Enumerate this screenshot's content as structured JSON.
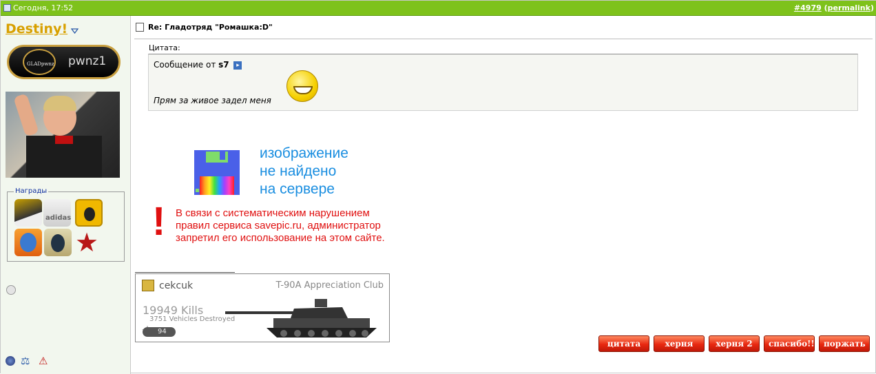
{
  "header": {
    "date": "Сегодня, 17:52",
    "post_number": "#4979",
    "permalink": "permalink"
  },
  "user": {
    "name": "Destiny!",
    "clan_tag": "pwnz1",
    "clan_emblem_text": "GLADpwnz"
  },
  "awards": {
    "legend": "Награды",
    "items": [
      "stripes-award",
      "adidas-award",
      "medal-award",
      "masked-hero-award",
      "counter-strike-award",
      "soviet-star-award"
    ],
    "adidas_text": "adidas"
  },
  "post": {
    "title": "Re: Гладотряд \"Ромашка:D\"",
    "quote_label": "Цитата:",
    "quote_from_prefix": "Сообщение от",
    "quote_author": "s7",
    "quote_text": "Прям за живое задел меня",
    "image_error": {
      "line1": "изображение",
      "line2": "не найдено",
      "line3": "на сервере",
      "exclamation": "!",
      "v1": "В связи с систематическим нарушением",
      "v2": "правил сервиса savepic.ru, администратор",
      "v3": "запретил его использование на этом сайте."
    }
  },
  "signature": {
    "player": "cekcuk",
    "club": "T-90A Appreciation Club",
    "kills": "19949 Kills",
    "vehicles": "3751 Vehicles Destroyed",
    "level": "94"
  },
  "buttons": {
    "quote": "цитата",
    "b2": "херня",
    "b3": "херня 2",
    "thanks": "спасибо!!!",
    "laugh": "поржать"
  }
}
